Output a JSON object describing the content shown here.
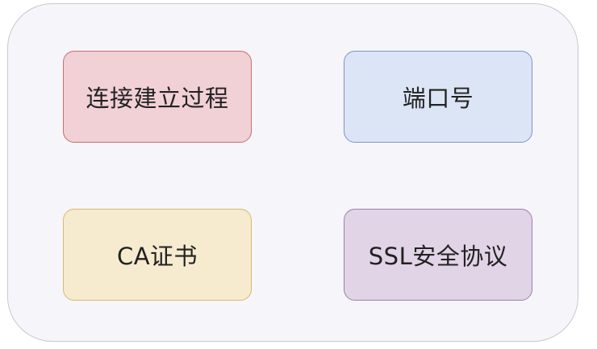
{
  "boxes": [
    {
      "label": "连接建立过程",
      "fill": "#f1d0d6",
      "border": "#c4706f"
    },
    {
      "label": "端口号",
      "fill": "#dce5f5",
      "border": "#7b96c7"
    },
    {
      "label": "CA证书",
      "fill": "#f6ebcf",
      "border": "#d6bb6b"
    },
    {
      "label": "SSL安全协议",
      "fill": "#e1d4e6",
      "border": "#9c80a9"
    }
  ]
}
